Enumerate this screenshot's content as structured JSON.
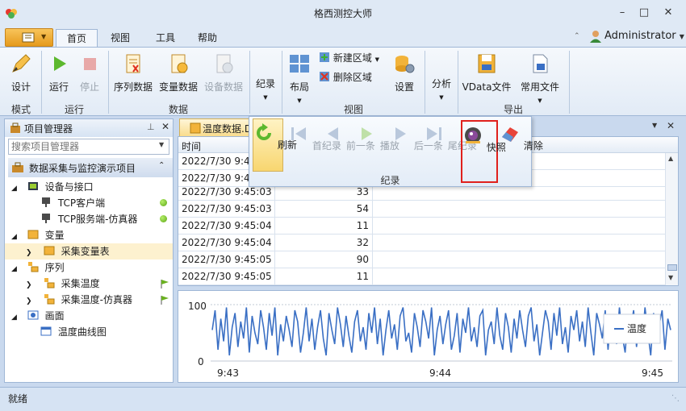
{
  "app": {
    "title": "格西测控大师"
  },
  "ribbon_tabs": [
    "首页",
    "视图",
    "工具",
    "帮助"
  ],
  "user": "Administrator",
  "ribbon": {
    "mode": {
      "design": "设计",
      "group": "模式"
    },
    "run": {
      "run": "运行",
      "stop": "停止",
      "group": "运行"
    },
    "data": {
      "seq": "序列数据",
      "var": "变量数据",
      "dev": "设备数据",
      "group": "数据"
    },
    "record": "纪录",
    "view": {
      "layout": "布局",
      "new_area": "新建区域",
      "del_area": "删除区域",
      "settings": "设置",
      "group": "视图"
    },
    "analysis": "分析",
    "export": {
      "vdata": "VData文件",
      "common": "常用文件",
      "group": "导出"
    }
  },
  "project_panel": {
    "title": "项目管理器",
    "search_placeholder": "搜索项目管理器",
    "project": "数据采集与监控演示项目",
    "tree": [
      {
        "label": "设备与接口",
        "level": 0,
        "icon": "device-icon"
      },
      {
        "label": "TCP客户端",
        "level": 1,
        "icon": "tcp-client-icon",
        "status": "ok"
      },
      {
        "label": "TCP服务端-仿真器",
        "level": 1,
        "icon": "tcp-server-icon",
        "status": "ok"
      },
      {
        "label": "变量",
        "level": 0,
        "icon": "variable-folder-icon"
      },
      {
        "label": "采集变量表",
        "level": 1,
        "icon": "variable-table-icon",
        "selected": true
      },
      {
        "label": "序列",
        "level": 0,
        "icon": "sequence-folder-icon"
      },
      {
        "label": "采集温度",
        "level": 1,
        "icon": "sequence-icon",
        "flag": true
      },
      {
        "label": "采集温度-仿真器",
        "level": 1,
        "icon": "sequence-icon",
        "flag": true
      },
      {
        "label": "画面",
        "level": 0,
        "icon": "screen-folder-icon"
      },
      {
        "label": "温度曲线图",
        "level": 1,
        "icon": "screen-icon"
      }
    ]
  },
  "doc_tab": "温度数据.D",
  "grid": {
    "header_time": "时间",
    "rows": [
      {
        "time": "2022/7/30 9:45",
        "value": ""
      },
      {
        "time": "2022/7/30 9:45",
        "value": ""
      },
      {
        "time": "2022/7/30 9:45:03",
        "value": "33"
      },
      {
        "time": "2022/7/30 9:45:03",
        "value": "54"
      },
      {
        "time": "2022/7/30 9:45:04",
        "value": "11"
      },
      {
        "time": "2022/7/30 9:45:04",
        "value": "32"
      },
      {
        "time": "2022/7/30 9:45:05",
        "value": "90"
      },
      {
        "time": "2022/7/30 9:45:05",
        "value": "11"
      }
    ]
  },
  "record_toolbar": {
    "refresh": "刷新",
    "first": "首纪录",
    "prev": "前一条",
    "play": "播放",
    "next": "后一条",
    "last": "尾纪录",
    "snapshot": "快照",
    "clear": "清除",
    "group": "纪录"
  },
  "chart_data": {
    "type": "line",
    "series": [
      {
        "name": "温度",
        "color": "#3a6fc4",
        "values": [
          55,
          90,
          20,
          75,
          35,
          95,
          10,
          60,
          85,
          25,
          70,
          40,
          95,
          15,
          80,
          50,
          30,
          90,
          60,
          20,
          85,
          45,
          95,
          10,
          65,
          35,
          80,
          55,
          25,
          90,
          70,
          15,
          50,
          95,
          35,
          75,
          20,
          60,
          90,
          40,
          10,
          85,
          55,
          30,
          95,
          65,
          25,
          80,
          45,
          15,
          70,
          90,
          35,
          60,
          20,
          85,
          50,
          95,
          30,
          75,
          10,
          55,
          90,
          40,
          65,
          20,
          80,
          95,
          35,
          50,
          15,
          85,
          60,
          25,
          90,
          70,
          40,
          95,
          10,
          55,
          80,
          30,
          65,
          90,
          20,
          45,
          85,
          15,
          75,
          50,
          95,
          35,
          60,
          25,
          80,
          90,
          10,
          55,
          70,
          30,
          95,
          45,
          20,
          85,
          60,
          15,
          75,
          40,
          90,
          55,
          25,
          80,
          95,
          35,
          65,
          10,
          50,
          90,
          70,
          20,
          85,
          45,
          95,
          30,
          60,
          15,
          80,
          55,
          90,
          35,
          70,
          25,
          95,
          50,
          10,
          85,
          65,
          40,
          90,
          20,
          75,
          55,
          30,
          95,
          45,
          15,
          80,
          60,
          90,
          25,
          70,
          35,
          95,
          50,
          10,
          85,
          40,
          65,
          90,
          20,
          75,
          55
        ]
      }
    ],
    "ylim": [
      0,
      100
    ],
    "yticks": [
      "100",
      "0"
    ],
    "xticks": [
      "9:43",
      "9:44",
      "9:45"
    ],
    "legend": "温度"
  },
  "status": "就绪"
}
